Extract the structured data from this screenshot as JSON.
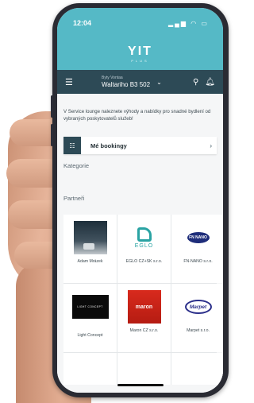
{
  "status": {
    "time": "12:04",
    "icons": "signal wifi battery"
  },
  "brand": {
    "logo": "YIT",
    "sub": "PLUS"
  },
  "project": {
    "label": "Byty Vontaa",
    "name": "Waltariho B3 502"
  },
  "intro_text": "V Service lounge naleznete výhody a nabídky pro snadné bydlení od vybraných poskytovatelů služeb!",
  "bookings": {
    "label": "Mé bookingy"
  },
  "sections": {
    "categories": "Kategorie",
    "partners": "Partneři"
  },
  "partners": [
    {
      "name": "Adam Mrázek"
    },
    {
      "name": "EGLO CZ+SK s.r.o.",
      "logo_text": "EGLO"
    },
    {
      "name": "FN-NANO s.r.o.",
      "logo_text": "FN NANO"
    },
    {
      "name": "Light Concept",
      "logo_text": "LIGHT CONCEPT"
    },
    {
      "name": "Maron CZ s.r.o.",
      "logo_text": "maron"
    },
    {
      "name": "Marpet s.r.o.",
      "logo_text": "Marpet"
    }
  ],
  "colors": {
    "header": "#55b9c6",
    "project_bar": "#2d4a56",
    "background": "#f5f6f7"
  }
}
